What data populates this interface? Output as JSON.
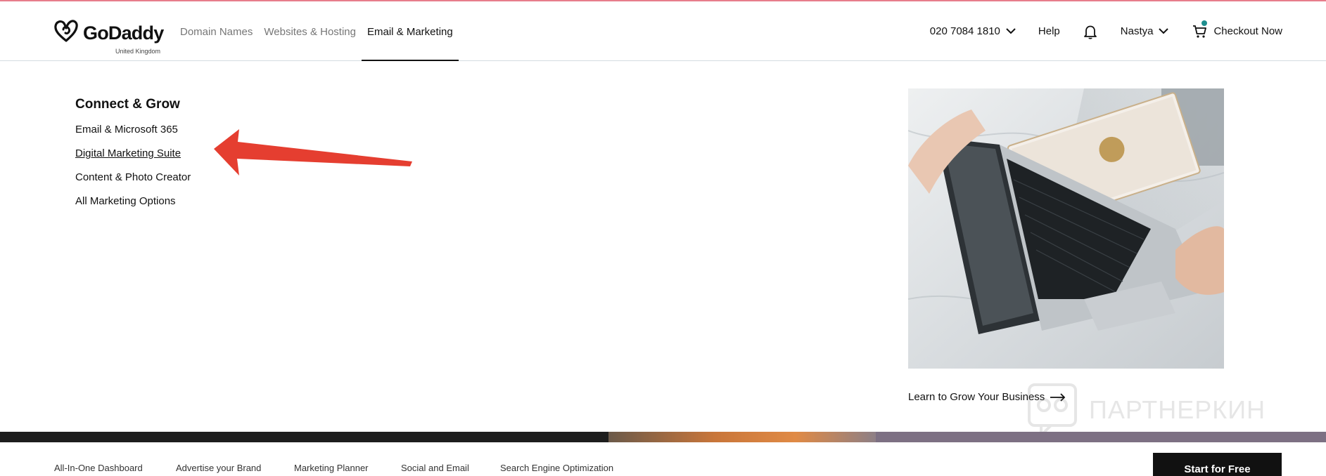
{
  "brand": {
    "name": "GoDaddy",
    "region": "United Kingdom"
  },
  "nav": {
    "items": [
      {
        "label": "Domain Names"
      },
      {
        "label": "Websites & Hosting"
      },
      {
        "label": "Email & Marketing"
      }
    ],
    "active_index": 2
  },
  "utility": {
    "phone": "020 7084 1810",
    "help": "Help",
    "user": "Nastya",
    "checkout": "Checkout Now"
  },
  "dropdown": {
    "heading": "Connect & Grow",
    "links": [
      {
        "label": "Email & Microsoft 365"
      },
      {
        "label": "Digital Marketing Suite"
      },
      {
        "label": "Content & Photo Creator"
      },
      {
        "label": "All Marketing Options"
      }
    ],
    "promo_link": "Learn to Grow Your Business"
  },
  "watermark": {
    "text": "ПАРТНЕРКИН"
  },
  "subnav": {
    "links": [
      {
        "label": "All-In-One Dashboard"
      },
      {
        "label": "Advertise your Brand"
      },
      {
        "label": "Marketing Planner"
      },
      {
        "label": "Social and Email"
      },
      {
        "label": "Search Engine Optimization"
      }
    ],
    "cta": "Start for Free"
  },
  "colors": {
    "text": "#111111",
    "muted": "#767676",
    "annotation_arrow": "#e53e30",
    "notification_dot": "#1f8e8e",
    "cta_bg": "#111111"
  },
  "icons": [
    "godaddy-logo-icon",
    "chevron-down-icon",
    "bell-icon",
    "cart-icon",
    "arrow-right-icon",
    "annotation-arrow-icon"
  ]
}
